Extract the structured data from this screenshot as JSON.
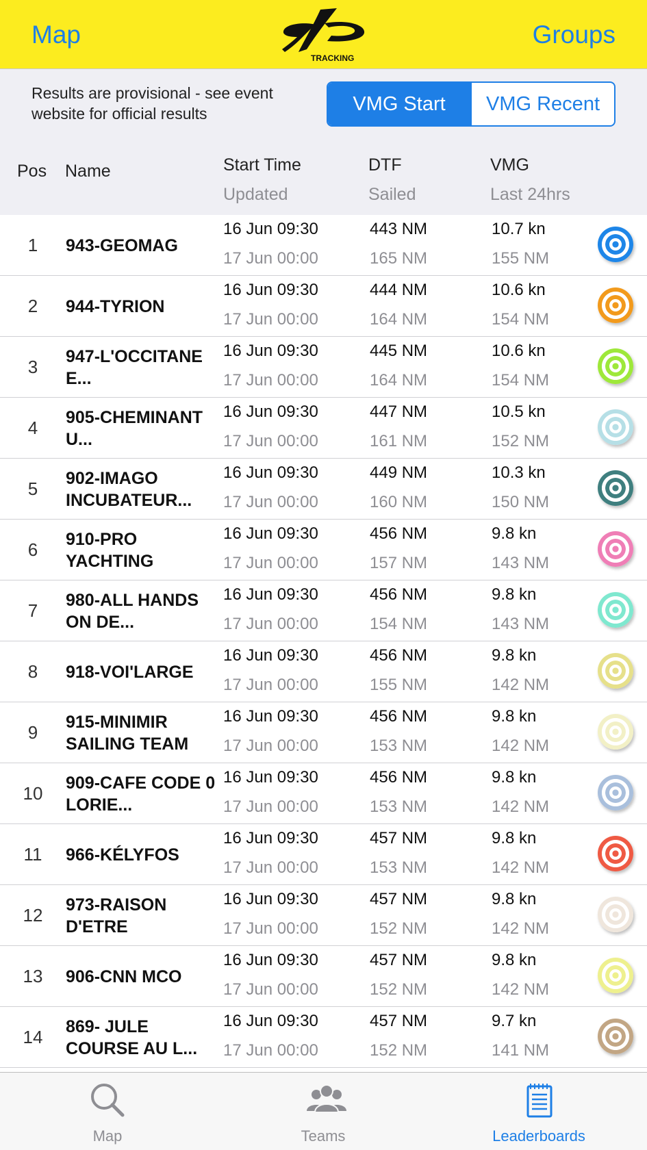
{
  "header": {
    "left_label": "Map",
    "right_label": "Groups",
    "logo_text": "TRACKING"
  },
  "notice": "Results are provisional - see event website for official results",
  "segments": [
    {
      "label": "VMG Start",
      "active": true
    },
    {
      "label": "VMG Recent",
      "active": false
    }
  ],
  "columns": {
    "pos": "Pos",
    "name": "Name",
    "start_time": "Start Time",
    "updated": "Updated",
    "dtf": "DTF",
    "sailed": "Sailed",
    "vmg": "VMG",
    "last24": "Last 24hrs"
  },
  "rows": [
    {
      "pos": "1",
      "name": "943-GEOMAG",
      "start": "16 Jun 09:30",
      "updated": "17 Jun 00:00",
      "dtf": "443 NM",
      "sailed": "165 NM",
      "vmg": "10.7 kn",
      "last24": "155 NM",
      "color": "#1e86e8"
    },
    {
      "pos": "2",
      "name": "944-TYRION",
      "start": "16 Jun 09:30",
      "updated": "17 Jun 00:00",
      "dtf": "444 NM",
      "sailed": "164 NM",
      "vmg": "10.6 kn",
      "last24": "154 NM",
      "color": "#f29a1c"
    },
    {
      "pos": "3",
      "name": "947-L'OCCITANE E...",
      "start": "16 Jun 09:30",
      "updated": "17 Jun 00:00",
      "dtf": "445 NM",
      "sailed": "164 NM",
      "vmg": "10.6 kn",
      "last24": "154 NM",
      "color": "#9ee83a"
    },
    {
      "pos": "4",
      "name": "905-CHEMINANT U...",
      "start": "16 Jun 09:30",
      "updated": "17 Jun 00:00",
      "dtf": "447 NM",
      "sailed": "161 NM",
      "vmg": "10.5 kn",
      "last24": "152 NM",
      "color": "#b6dfe6"
    },
    {
      "pos": "5",
      "name": "902-IMAGO INCUBATEUR...",
      "start": "16 Jun 09:30",
      "updated": "17 Jun 00:00",
      "dtf": "449 NM",
      "sailed": "160 NM",
      "vmg": "10.3 kn",
      "last24": "150 NM",
      "color": "#3f7f7f"
    },
    {
      "pos": "6",
      "name": "910-PRO YACHTING",
      "start": "16 Jun 09:30",
      "updated": "17 Jun 00:00",
      "dtf": "456 NM",
      "sailed": "157 NM",
      "vmg": "9.8 kn",
      "last24": "143 NM",
      "color": "#ef7eb6"
    },
    {
      "pos": "7",
      "name": "980-ALL HANDS ON DE...",
      "start": "16 Jun 09:30",
      "updated": "17 Jun 00:00",
      "dtf": "456 NM",
      "sailed": "154 NM",
      "vmg": "9.8 kn",
      "last24": "143 NM",
      "color": "#7fe8cf"
    },
    {
      "pos": "8",
      "name": "918-VOI'LARGE",
      "start": "16 Jun 09:30",
      "updated": "17 Jun 00:00",
      "dtf": "456 NM",
      "sailed": "155 NM",
      "vmg": "9.8 kn",
      "last24": "142 NM",
      "color": "#e6e08a"
    },
    {
      "pos": "9",
      "name": "915-MINIMIR SAILING TEAM",
      "start": "16 Jun 09:30",
      "updated": "17 Jun 00:00",
      "dtf": "456 NM",
      "sailed": "153 NM",
      "vmg": "9.8 kn",
      "last24": "142 NM",
      "color": "#f2f0c6"
    },
    {
      "pos": "10",
      "name": "909-CAFE CODE 0 LORIE...",
      "start": "16 Jun 09:30",
      "updated": "17 Jun 00:00",
      "dtf": "456 NM",
      "sailed": "153 NM",
      "vmg": "9.8 kn",
      "last24": "142 NM",
      "color": "#a9bfdc"
    },
    {
      "pos": "11",
      "name": "966-KÉLYFOS",
      "start": "16 Jun 09:30",
      "updated": "17 Jun 00:00",
      "dtf": "457 NM",
      "sailed": "153 NM",
      "vmg": "9.8 kn",
      "last24": "142 NM",
      "color": "#ef5a44"
    },
    {
      "pos": "12",
      "name": "973-RAISON D'ETRE",
      "start": "16 Jun 09:30",
      "updated": "17 Jun 00:00",
      "dtf": "457 NM",
      "sailed": "152 NM",
      "vmg": "9.8 kn",
      "last24": "142 NM",
      "color": "#efe6dc"
    },
    {
      "pos": "13",
      "name": "906-CNN MCO",
      "start": "16 Jun 09:30",
      "updated": "17 Jun 00:00",
      "dtf": "457 NM",
      "sailed": "152 NM",
      "vmg": "9.8 kn",
      "last24": "142 NM",
      "color": "#eef08e"
    },
    {
      "pos": "14",
      "name": "869- JULE COURSE AU L...",
      "start": "16 Jun 09:30",
      "updated": "17 Jun 00:00",
      "dtf": "457 NM",
      "sailed": "152 NM",
      "vmg": "9.7 kn",
      "last24": "141 NM",
      "color": "#c2a684"
    }
  ],
  "tabs": [
    {
      "label": "Map",
      "icon": "magnifier-icon",
      "active": false
    },
    {
      "label": "Teams",
      "icon": "people-icon",
      "active": false
    },
    {
      "label": "Leaderboards",
      "icon": "notepad-icon",
      "active": true
    }
  ],
  "colors": {
    "accent": "#1e7fe6",
    "header_bg": "#fcec1f",
    "muted": "#8e8e93"
  }
}
